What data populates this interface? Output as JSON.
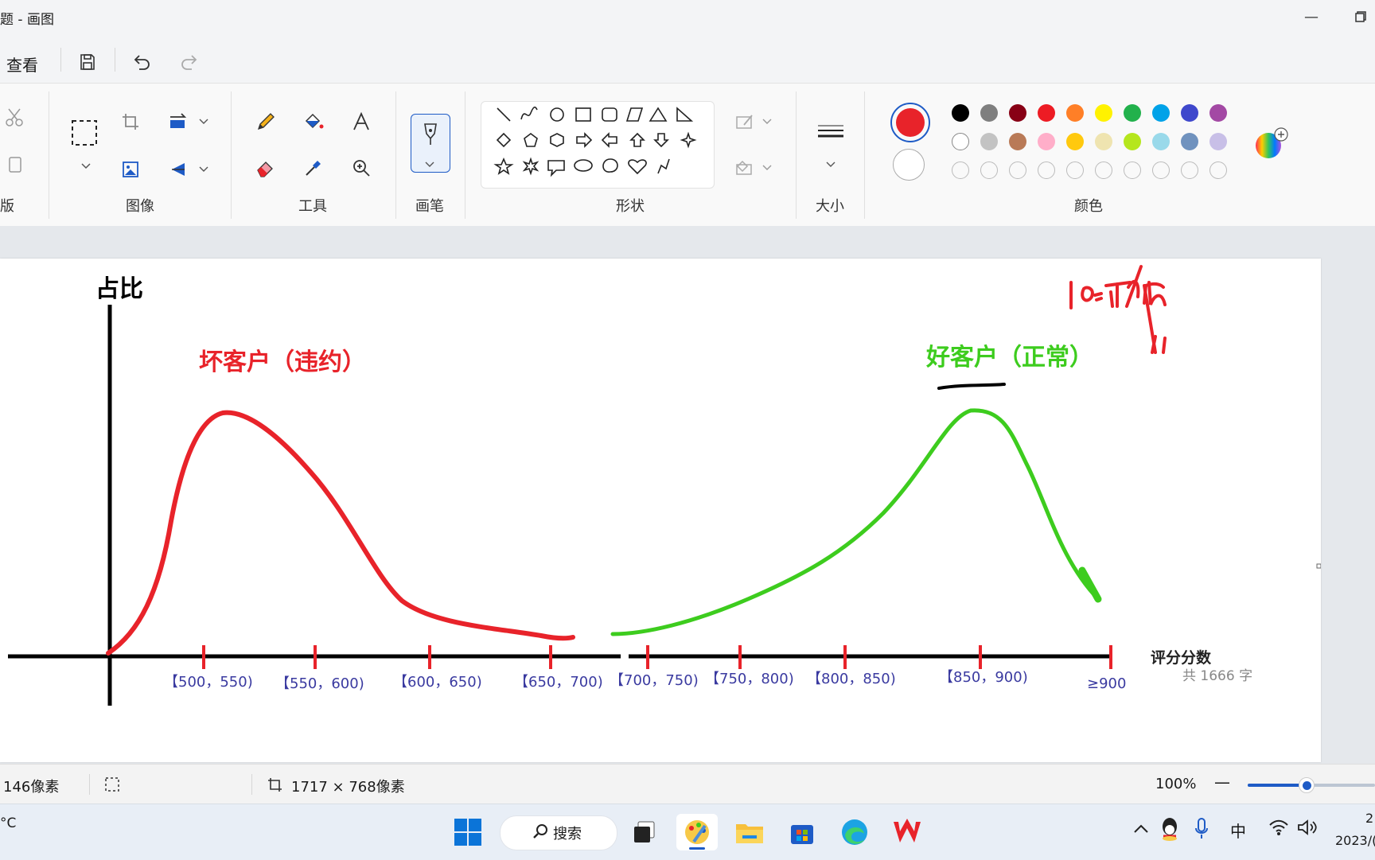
{
  "window": {
    "title": "题 - 画图",
    "minimize_icon": "minimize-icon",
    "restore_icon": "restore-icon"
  },
  "menu": {
    "view_label": "查看"
  },
  "ribbon": {
    "groups": {
      "clipboard": "版",
      "image": "图像",
      "tools": "工具",
      "brush": "画笔",
      "shapes": "形状",
      "size": "大小",
      "colors": "颜色"
    },
    "primary_color": "#e8232a",
    "secondary_color": "#ffffff",
    "palette_row1": [
      "#000000",
      "#7f7f7f",
      "#880015",
      "#ed1c24",
      "#ff7f27",
      "#fff200",
      "#22b14c",
      "#00a2e8",
      "#3f48cc",
      "#a349a4"
    ],
    "palette_row2": [
      "#ffffff",
      "#c3c3c3",
      "#b97a57",
      "#ffaec9",
      "#ffc90e",
      "#efe4b0",
      "#b5e61d",
      "#99d9ea",
      "#7092be",
      "#c8bfe7"
    ]
  },
  "drawing": {
    "y_axis_label": "占比",
    "x_axis_label": "评分分数",
    "bad_label": "坏客户（违约）",
    "good_label": "好客户（正常）",
    "word_count": "共 1666 字",
    "ticks": [
      "【500，550)",
      "【550，600)",
      "【600，650)",
      "【650，700)",
      "【700，750)",
      "【750，800)",
      "【800，850)",
      "【850，900)",
      "≥900"
    ],
    "colors": {
      "bad": "#e8232a",
      "good": "#3dcc1e",
      "axis": "#000000",
      "tick_text": "#3a3aa0"
    }
  },
  "status": {
    "position": "146像素",
    "canvas_size": "1717 × 768像素",
    "zoom": "100%"
  },
  "taskbar": {
    "weather": "°C",
    "search_label": "搜索",
    "ime": "中",
    "time": "2",
    "date": "2023/("
  }
}
